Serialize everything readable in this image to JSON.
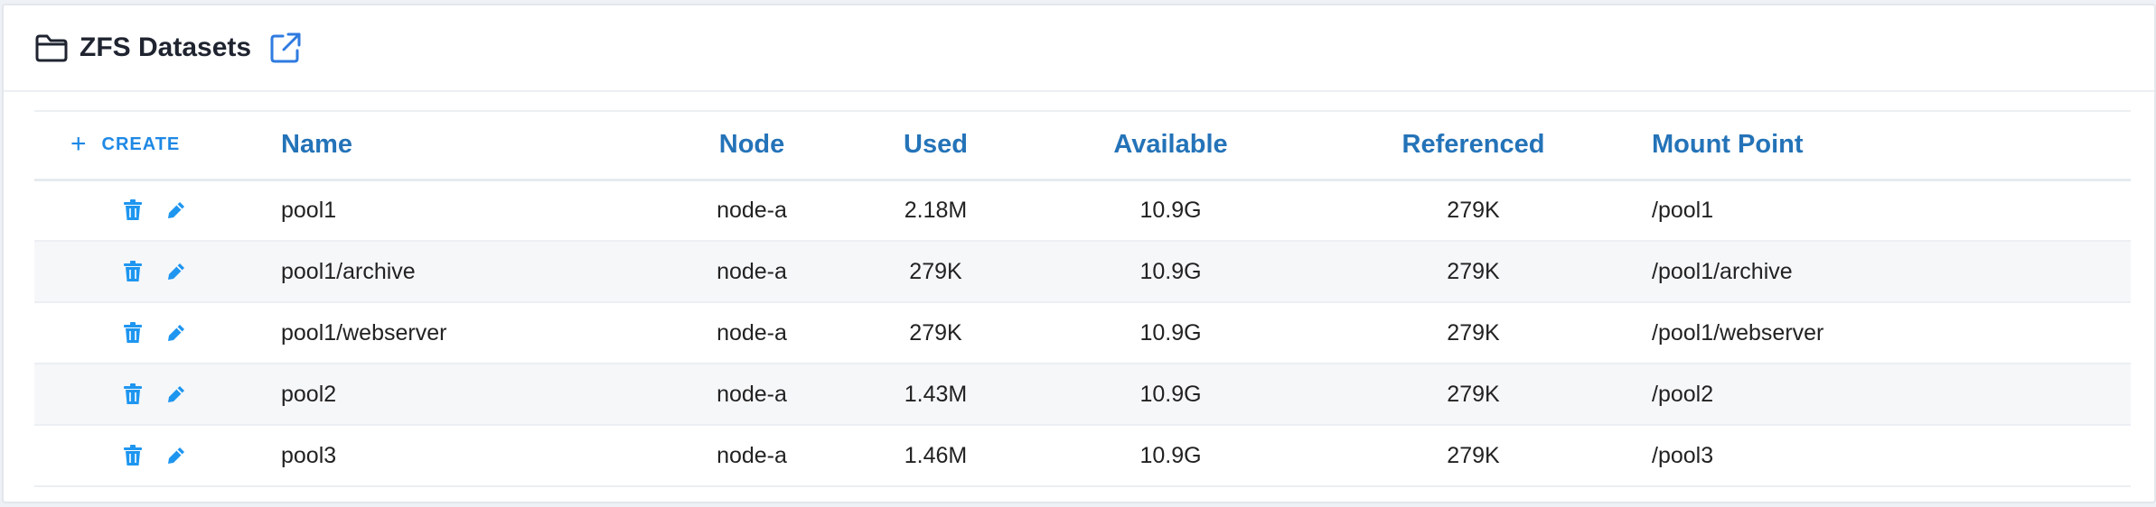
{
  "header": {
    "title": "ZFS Datasets"
  },
  "toolbar": {
    "create_label": "CREATE"
  },
  "columns": {
    "name": "Name",
    "node": "Node",
    "used": "Used",
    "available": "Available",
    "referenced": "Referenced",
    "mount": "Mount Point"
  },
  "rows": [
    {
      "name": "pool1",
      "node": "node-a",
      "used": "2.18M",
      "available": "10.9G",
      "referenced": "279K",
      "mount": "/pool1"
    },
    {
      "name": "pool1/archive",
      "node": "node-a",
      "used": "279K",
      "available": "10.9G",
      "referenced": "279K",
      "mount": "/pool1/archive"
    },
    {
      "name": "pool1/webserver",
      "node": "node-a",
      "used": "279K",
      "available": "10.9G",
      "referenced": "279K",
      "mount": "/pool1/webserver"
    },
    {
      "name": "pool2",
      "node": "node-a",
      "used": "1.43M",
      "available": "10.9G",
      "referenced": "279K",
      "mount": "/pool2"
    },
    {
      "name": "pool3",
      "node": "node-a",
      "used": "1.46M",
      "available": "10.9G",
      "referenced": "279K",
      "mount": "/pool3"
    }
  ],
  "colors": {
    "accent": "#1e88e5",
    "header_text": "#2473b8",
    "icon": "#1e96f0"
  },
  "icons": {
    "title": "folder-icon",
    "external": "external-link-icon",
    "delete": "trash-icon",
    "edit": "pencil-icon"
  }
}
